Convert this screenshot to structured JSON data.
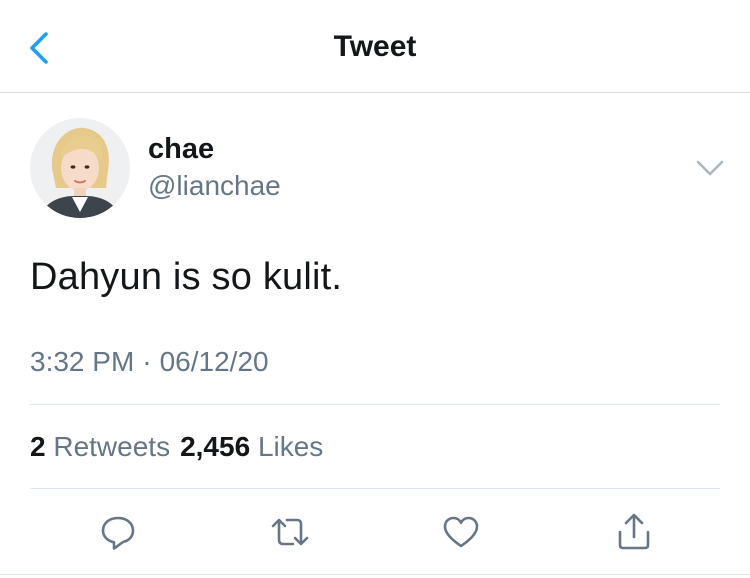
{
  "navbar": {
    "title": "Tweet",
    "back_icon": "chevron-left-icon"
  },
  "author": {
    "display_name": "chae",
    "handle": "@lianchae",
    "avatar": "user-avatar-photo"
  },
  "tweet": {
    "text": "Dahyun is so kulit."
  },
  "meta": {
    "time": "3:32 PM",
    "separator": "·",
    "date": "06/12/20"
  },
  "stats": {
    "retweets_count": "2",
    "retweets_label": "Retweets",
    "likes_count": "2,456",
    "likes_label": "Likes"
  },
  "actions": [
    "reply-icon",
    "retweet-icon",
    "like-icon",
    "share-icon"
  ],
  "colors": {
    "accent": "#1da1f2",
    "text_primary": "#14171a",
    "text_secondary": "#657786",
    "icon": "#657786"
  }
}
